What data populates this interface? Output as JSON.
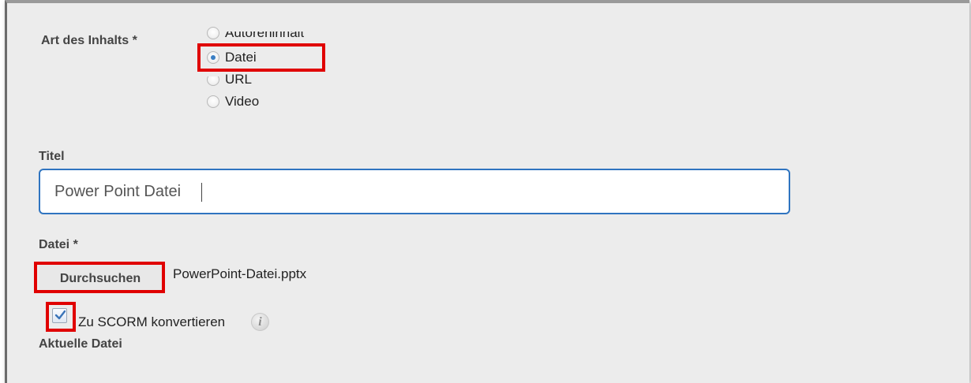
{
  "content_type": {
    "label": "Art des Inhalts *",
    "options": [
      {
        "label": "Autoreninhalt",
        "checked": false
      },
      {
        "label": "Datei",
        "checked": true
      },
      {
        "label": "URL",
        "checked": false
      },
      {
        "label": "Video",
        "checked": false
      }
    ]
  },
  "title_field": {
    "label": "Titel",
    "value": "Power Point Datei"
  },
  "file_field": {
    "label": "Datei *",
    "browse_label": "Durchsuchen",
    "file_name": "PowerPoint-Datei.pptx"
  },
  "scorm": {
    "label": "Zu SCORM konvertieren",
    "checked": true,
    "info_icon": "info-icon",
    "info_glyph": "i"
  },
  "current_file": {
    "label": "Aktuelle Datei"
  },
  "colors": {
    "highlight": "#e00000",
    "focus_border": "#2f74c0",
    "panel_bg": "#ececec"
  }
}
